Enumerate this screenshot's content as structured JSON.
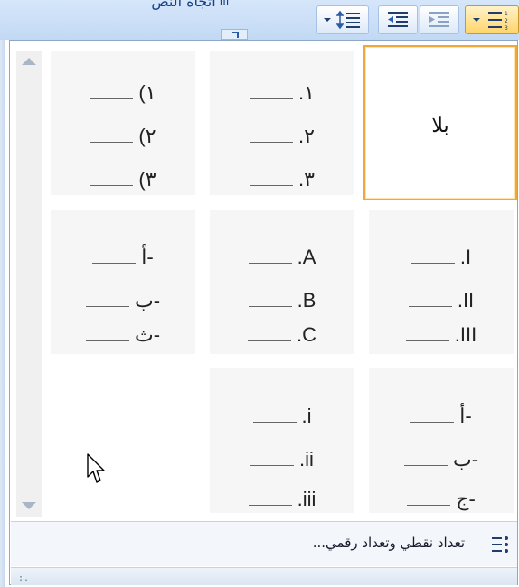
{
  "ribbon": {
    "text_direction_label": "اتجاه النص",
    "text_direction_mark": "ااا",
    "buttons": [
      {
        "name": "line-spacing",
        "icon": "line-spacing-icon"
      },
      {
        "name": "decrease-indent",
        "icon": "decrease-indent-icon"
      },
      {
        "name": "increase-indent",
        "icon": "increase-indent-icon"
      },
      {
        "name": "numbering",
        "icon": "numbering-icon",
        "active": true
      }
    ]
  },
  "gallery": {
    "tiles": [
      {
        "id": "none",
        "label": "بلا",
        "selected": true
      },
      {
        "id": "arabic-dot",
        "markers": [
          ".١",
          ".٢",
          ".٣"
        ]
      },
      {
        "id": "arabic-paren",
        "markers": [
          "(١",
          "(٢",
          "(٣"
        ]
      },
      {
        "id": "roman-upper",
        "markers": [
          ".I",
          ".II",
          ".III"
        ]
      },
      {
        "id": "alpha-upper",
        "markers": [
          ".A",
          ".B",
          ".C"
        ]
      },
      {
        "id": "abjad-1",
        "markers": [
          "أ-",
          "ب-",
          "ث-"
        ]
      },
      {
        "id": "abjad-2",
        "markers": [
          "أ-",
          "ب-",
          "ج-"
        ]
      },
      {
        "id": "roman-lower",
        "markers": [
          ".i",
          ".ii",
          ".iii"
        ]
      }
    ]
  },
  "footer": {
    "label": "تعداد نقطي وتعداد رقمي...",
    "icon": "bullets-numbering-icon"
  },
  "statusbar": {
    "grip": ":."
  },
  "colors": {
    "ribbon": "#c2d9f4",
    "selected_border": "#f1a83a",
    "tile_bg": "#f6f6f6"
  }
}
